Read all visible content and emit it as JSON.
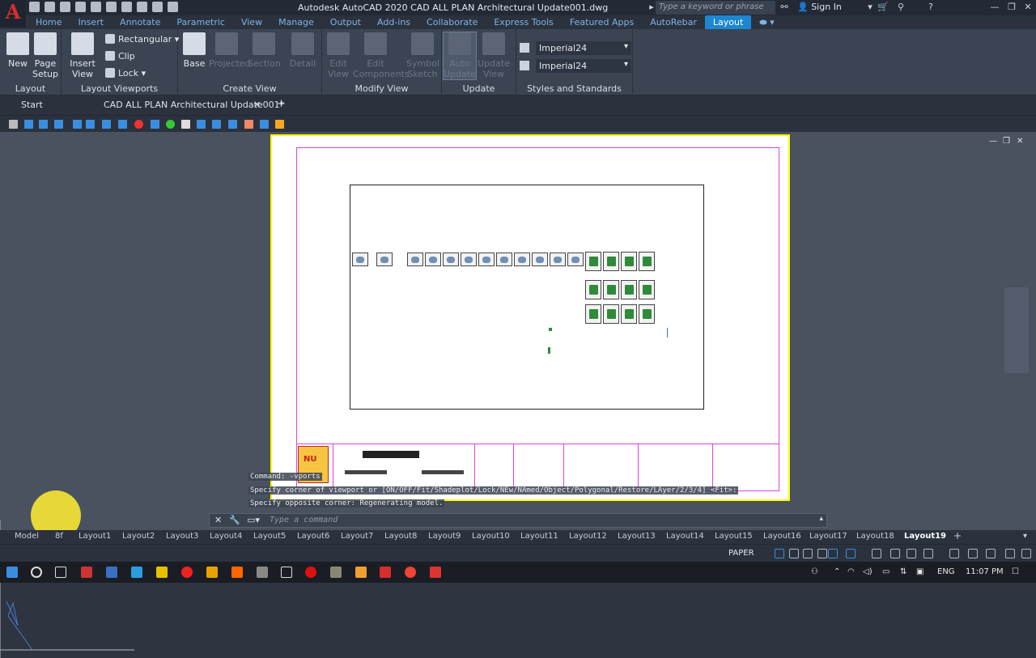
{
  "app": {
    "logo": "A",
    "window_title": "Autodesk AutoCAD 2020    CAD ALL PLAN Architectural Update001.dwg",
    "search_placeholder": "Type a keyword or phrase",
    "sign_in": "Sign In"
  },
  "ribbon_tabs": [
    "Home",
    "Insert",
    "Annotate",
    "Parametric",
    "View",
    "Manage",
    "Output",
    "Add-ins",
    "Collaborate",
    "Express Tools",
    "Featured Apps",
    "AutoRebar",
    "Layout"
  ],
  "active_ribbon_tab": "Layout",
  "ribbon": {
    "layout_panel": {
      "label": "Layout",
      "new": "New",
      "page_setup": "Page\nSetup"
    },
    "viewports_panel": {
      "label": "Layout Viewports",
      "insert_view": "Insert View",
      "rectangular": "Rectangular",
      "clip": "Clip",
      "lock": "Lock"
    },
    "create_view_panel": {
      "label": "Create View",
      "base": "Base",
      "projected": "Projected",
      "section": "Section",
      "detail": "Detail"
    },
    "modify_view_panel": {
      "label": "Modify View",
      "edit_view": "Edit\nView",
      "edit_components": "Edit\nComponents",
      "symbol_sketch": "Symbol\nSketch"
    },
    "update_panel": {
      "label": "Update",
      "auto_update": "Auto\nUpdate",
      "update_view": "Update\nView"
    },
    "styles_panel": {
      "label": "Styles and Standards",
      "style1": "Imperial24",
      "style2": "Imperial24"
    }
  },
  "doc_tabs": {
    "start": "Start",
    "file": "CAD ALL PLAN Architectural Update001*"
  },
  "command": {
    "history1": "Command:  -vports",
    "history2": "Specify corner of viewport or [ON/OFF/Fit/Shadeplot/Lock/NEw/NAmed/Object/Polygonal/Restore/LAyer/2/3/4] <Fit>:",
    "history3": "Specify opposite corner: Regenerating model.",
    "placeholder": "Type a command"
  },
  "layout_tabs": [
    "Model",
    "8f",
    "Layout1",
    "Layout2",
    "Layout3",
    "Layout4",
    "Layout5",
    "Layout6",
    "Layout7",
    "Layout8",
    "Layout9",
    "Layout10",
    "Layout11",
    "Layout12",
    "Layout13",
    "Layout14",
    "Layout15",
    "Layout16",
    "Layout17",
    "Layout18",
    "Layout19"
  ],
  "active_layout": "Layout19",
  "status": {
    "space": "PAPER"
  },
  "taskbar": {
    "lang": "ENG",
    "time": "11:07 PM"
  },
  "colors": {
    "accent": "#1c87d1",
    "paper_border": "#ffff00",
    "margin": "#e040e0",
    "autocad_red": "#d62d2d"
  }
}
